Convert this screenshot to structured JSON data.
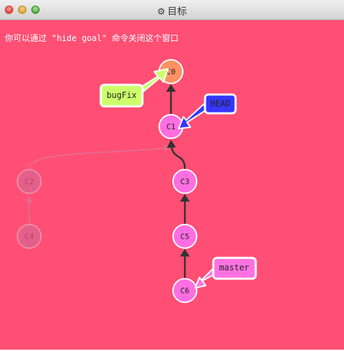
{
  "window": {
    "title": "目标",
    "title_icon": "gear-icon"
  },
  "hint": {
    "text": "你可以通过 \"hide goal\" 命令关闭这个窗口"
  },
  "colors": {
    "background": "#ff4f74",
    "c0": "#ff9263",
    "commit": "#ff6ee1",
    "faded_commit": "#e3608a",
    "bugFix_tag": "#cdff6b",
    "head_tag": "#3636ff",
    "master_tag": "#ff72e2"
  },
  "commits": {
    "c0": "C0",
    "c1": "C1",
    "c2": "C2",
    "c3": "C3",
    "c4": "C4",
    "c5": "C5",
    "c6": "C6"
  },
  "branches": {
    "bugFix": "bugFix",
    "head": "HEAD",
    "master": "master"
  }
}
